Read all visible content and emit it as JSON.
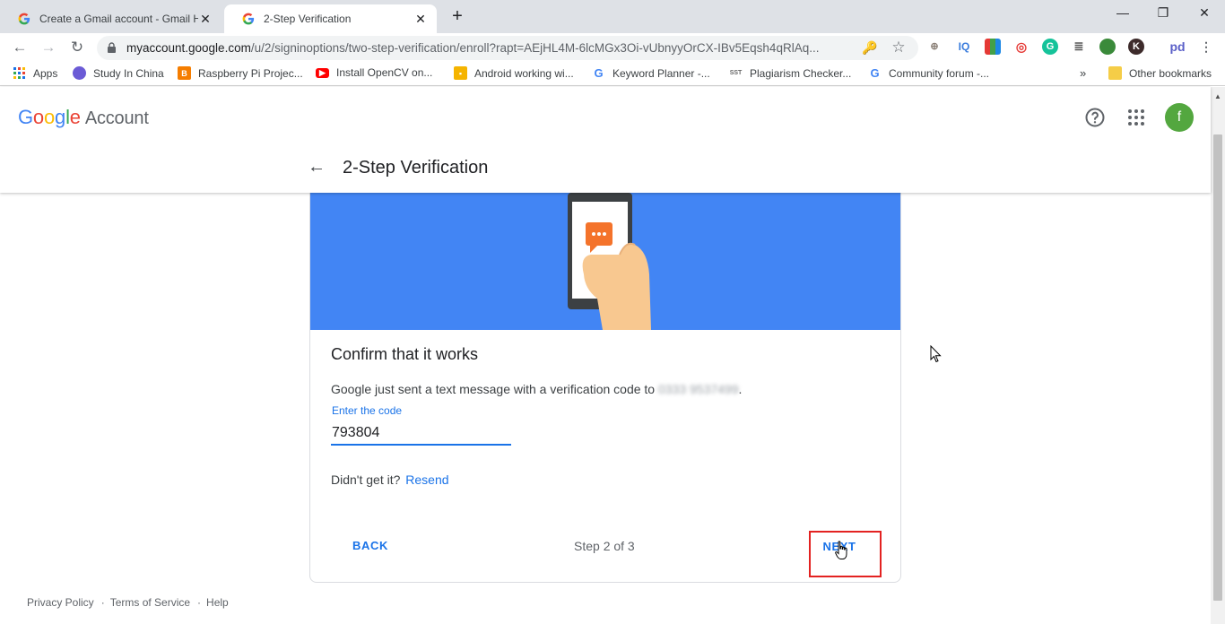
{
  "browser": {
    "tabs": [
      {
        "title": "Create a Gmail account - Gmail H",
        "active": false
      },
      {
        "title": "2-Step Verification",
        "active": true
      }
    ],
    "new_tab": "+",
    "window_controls": {
      "minimize": "—",
      "restore": "❐",
      "close": "✕"
    },
    "url_host": "myaccount.google.com",
    "url_path": "/u/2/signinoptions/two-step-verification/enroll?rapt=AEjHL4M-6lcMGx3Oi-vUbnyyOrCX-IBv5Eqsh4qRlAq...",
    "bookmarks": [
      {
        "label": "Apps",
        "icon": "apps-grid-icon"
      },
      {
        "label": "Study In China",
        "icon": "study-icon"
      },
      {
        "label": "Raspberry Pi Projec...",
        "icon": "blogger-icon"
      },
      {
        "label": "Install OpenCV on...",
        "icon": "youtube-icon"
      },
      {
        "label": "Android working wi...",
        "icon": "android-icon"
      },
      {
        "label": "Keyword Planner -...",
        "icon": "google-icon"
      },
      {
        "label": "Plagiarism Checker...",
        "icon": "sst-icon",
        "icon_text": "SST"
      },
      {
        "label": "Community forum -...",
        "icon": "google-icon"
      }
    ],
    "more_bookmarks": "»",
    "other_bookmarks": "Other bookmarks"
  },
  "header": {
    "logo_google": "Google",
    "logo_account": "Account",
    "avatar_letter": "f",
    "page_title": "2-Step Verification"
  },
  "card": {
    "title": "Confirm that it works",
    "description": "Google just sent a text message with a verification code to",
    "phone_masked": "0333 9537499",
    "period": ".",
    "code_label": "Enter the code",
    "code_value": "793804",
    "didnt_get": "Didn't get it?",
    "resend": "Resend",
    "back": "BACK",
    "step": "Step 2 of 3",
    "next": "NEXT"
  },
  "footer": {
    "privacy": "Privacy Policy",
    "terms": "Terms of Service",
    "help": "Help",
    "separator": "·"
  },
  "colors": {
    "banner": "#4285f4",
    "link_blue": "#1a73e8",
    "highlight_red": "#e32221",
    "avatar_green": "#53a73f"
  }
}
